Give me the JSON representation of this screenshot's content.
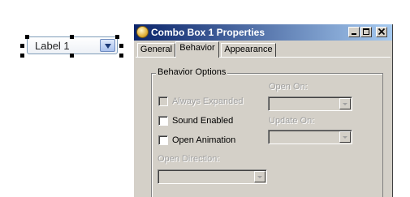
{
  "canvas": {
    "combo_text": "Label 1"
  },
  "dialog": {
    "title": "Combo Box 1 Properties",
    "tabs": [
      {
        "label": "General",
        "active": false
      },
      {
        "label": "Behavior",
        "active": true
      },
      {
        "label": "Appearance",
        "active": false
      }
    ],
    "group_label": "Behavior Options",
    "options": [
      {
        "label": "Always Expanded",
        "checked": false,
        "enabled": false
      },
      {
        "label": "Sound Enabled",
        "checked": false,
        "enabled": true
      },
      {
        "label": "Open Animation",
        "checked": false,
        "enabled": true
      }
    ],
    "open_on_label": "Open On:",
    "update_on_label": "Update On:",
    "open_direction_label": "Open Direction:"
  }
}
